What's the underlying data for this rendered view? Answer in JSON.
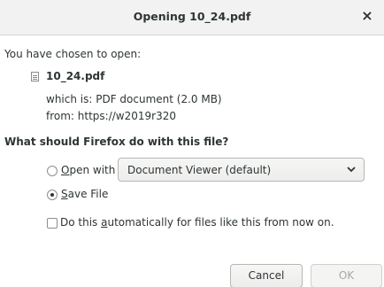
{
  "window": {
    "title": "Opening 10_24.pdf",
    "close_glyph": "×"
  },
  "content": {
    "chosen_label": "You have chosen to open:",
    "file_name": "10_24.pdf",
    "which_is": "which is: PDF document (2.0 MB)",
    "from": "from: https://w2019r320",
    "question": "What should Firefox do with this file?"
  },
  "options": {
    "open_with": {
      "accel": "O",
      "rest": "pen with",
      "selected": false,
      "app": "Document Viewer (default)"
    },
    "save_file": {
      "accel": "S",
      "rest": "ave File",
      "selected": true
    }
  },
  "auto": {
    "before": "Do this ",
    "accel": "a",
    "after": "utomatically for files like this from now on.",
    "checked": false
  },
  "buttons": {
    "cancel": "Cancel",
    "ok": "OK",
    "ok_disabled": true
  },
  "icons": {
    "close": "close-icon",
    "file": "file-icon",
    "dropdown": "chevron-down-icon"
  },
  "colors": {
    "titlebar_bg": "#f2f2f2",
    "text": "#2e3436",
    "disabled_text": "#a6a8a8"
  }
}
